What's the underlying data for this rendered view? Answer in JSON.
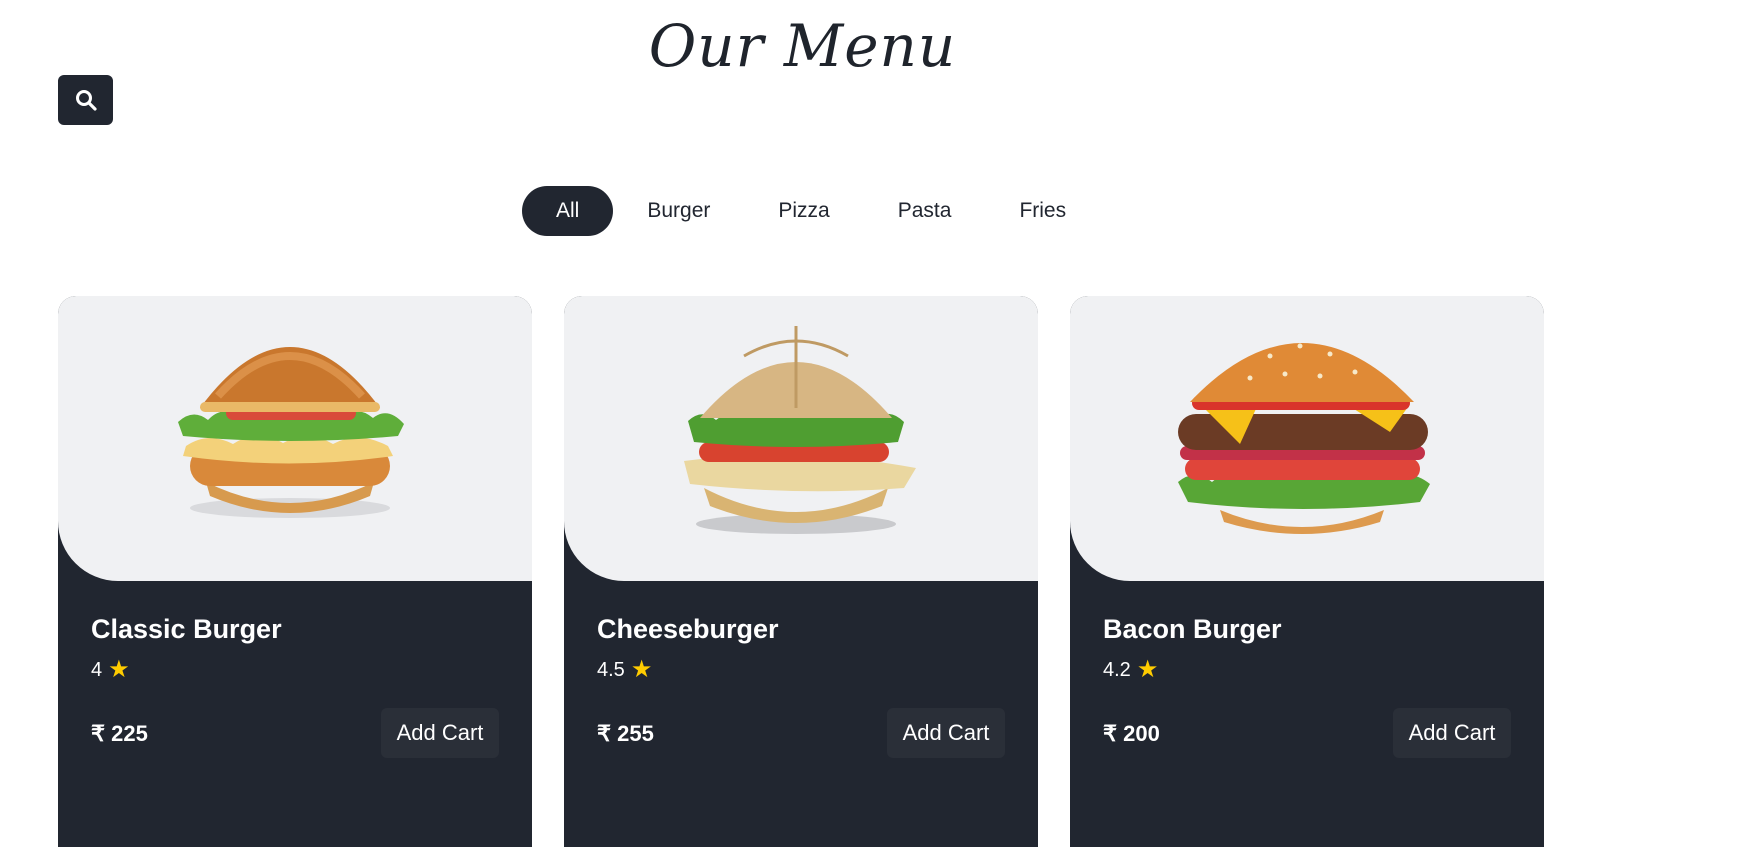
{
  "header": {
    "title": "Our Menu"
  },
  "search": {
    "icon": "search-icon"
  },
  "filters": [
    {
      "label": "All",
      "active": true
    },
    {
      "label": "Burger",
      "active": false
    },
    {
      "label": "Pizza",
      "active": false
    },
    {
      "label": "Pasta",
      "active": false
    },
    {
      "label": "Fries",
      "active": false
    }
  ],
  "items": [
    {
      "name": "Classic Burger",
      "rating": "4",
      "price": "₹ 225",
      "button": "Add Cart",
      "image": "classic-burger-image"
    },
    {
      "name": "Cheeseburger",
      "rating": "4.5",
      "price": "₹ 255",
      "button": "Add Cart",
      "image": "cheeseburger-image"
    },
    {
      "name": "Bacon Burger",
      "rating": "4.2",
      "price": "₹ 200",
      "button": "Add Cart",
      "image": "bacon-burger-image"
    }
  ],
  "colors": {
    "dark": "#212630",
    "card_image_bg": "#f0f1f3",
    "star": "#ffcc00"
  }
}
